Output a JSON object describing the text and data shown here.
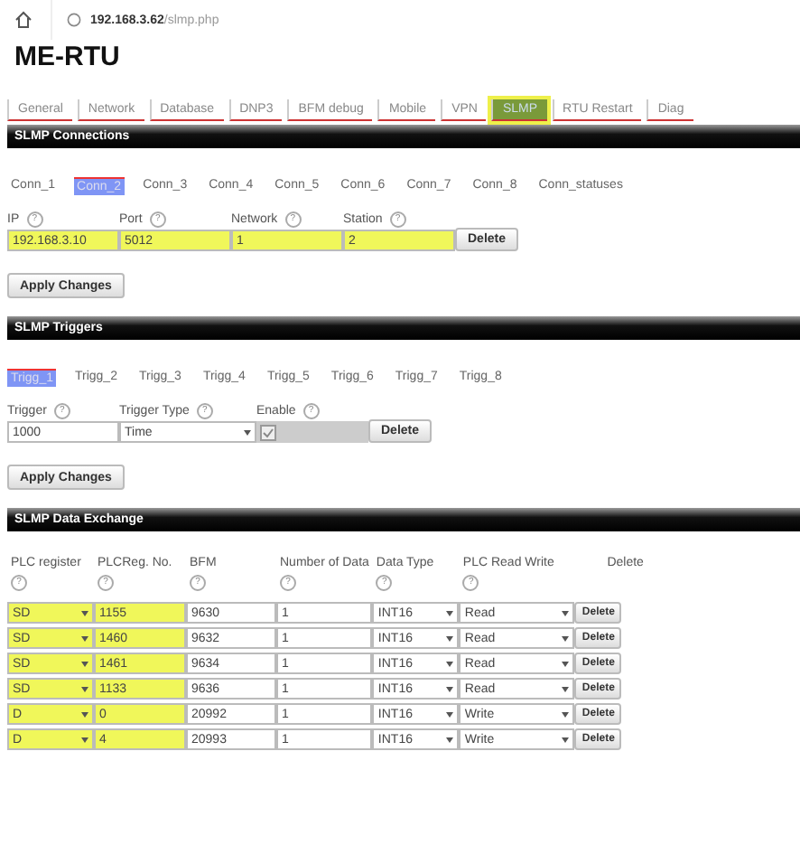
{
  "browser": {
    "url_host": "192.168.3.62",
    "url_path": "/slmp.php"
  },
  "title": "ME-RTU",
  "nav_tabs": [
    {
      "label": "General",
      "selected": false
    },
    {
      "label": "Network",
      "selected": false
    },
    {
      "label": "Database",
      "selected": false
    },
    {
      "label": "DNP3",
      "selected": false
    },
    {
      "label": "BFM debug",
      "selected": false
    },
    {
      "label": "Mobile",
      "selected": false
    },
    {
      "label": "VPN",
      "selected": false
    },
    {
      "label": "SLMP",
      "selected": true
    },
    {
      "label": "RTU Restart",
      "selected": false
    },
    {
      "label": "Diag",
      "selected": false
    }
  ],
  "connections": {
    "header": "SLMP Connections",
    "tabs": [
      {
        "label": "Conn_1",
        "selected": false
      },
      {
        "label": "Conn_2",
        "selected": true
      },
      {
        "label": "Conn_3",
        "selected": false
      },
      {
        "label": "Conn_4",
        "selected": false
      },
      {
        "label": "Conn_5",
        "selected": false
      },
      {
        "label": "Conn_6",
        "selected": false
      },
      {
        "label": "Conn_7",
        "selected": false
      },
      {
        "label": "Conn_8",
        "selected": false
      },
      {
        "label": "Conn_statuses",
        "selected": false
      }
    ],
    "fields": [
      {
        "label": "IP",
        "help": "?",
        "value": "192.168.3.10",
        "highlighted": true
      },
      {
        "label": "Port",
        "help": "?",
        "value": "5012",
        "highlighted": true
      },
      {
        "label": "Network",
        "help": "?",
        "value": "1",
        "highlighted": true
      },
      {
        "label": "Station",
        "help": "?",
        "value": "2",
        "highlighted": true
      }
    ],
    "delete_button": "Delete",
    "apply_button": "Apply Changes"
  },
  "triggers": {
    "header": "SLMP Triggers",
    "tabs": [
      {
        "label": "Trigg_1",
        "selected": true
      },
      {
        "label": "Trigg_2",
        "selected": false
      },
      {
        "label": "Trigg_3",
        "selected": false
      },
      {
        "label": "Trigg_4",
        "selected": false
      },
      {
        "label": "Trigg_5",
        "selected": false
      },
      {
        "label": "Trigg_6",
        "selected": false
      },
      {
        "label": "Trigg_7",
        "selected": false
      },
      {
        "label": "Trigg_8",
        "selected": false
      }
    ],
    "trigger_label": "Trigger",
    "trigger_help": "?",
    "trigger_value": "1000",
    "type_label": "Trigger Type",
    "type_help": "?",
    "type_value": "Time",
    "enable_label": "Enable",
    "enable_help": "?",
    "enable_checked": true,
    "delete_button": "Delete",
    "apply_button": "Apply Changes"
  },
  "data_exchange": {
    "header": "SLMP Data Exchange",
    "columns": [
      {
        "label": "PLC register",
        "help": "?"
      },
      {
        "label": "PLCReg. No.",
        "help": "?"
      },
      {
        "label": "BFM",
        "help": "?"
      },
      {
        "label": "Number of Data",
        "help": "?"
      },
      {
        "label": "Data Type",
        "help": "?"
      },
      {
        "label": "PLC Read Write",
        "help": "?"
      },
      {
        "label": "Delete"
      }
    ],
    "rows": [
      {
        "register": "SD",
        "reg_no": "1155",
        "highlighted": true,
        "bfm": "9630",
        "count": "1",
        "type": "INT16",
        "rw": "Read",
        "delete": "Delete"
      },
      {
        "register": "SD",
        "reg_no": "1460",
        "highlighted": true,
        "bfm": "9632",
        "count": "1",
        "type": "INT16",
        "rw": "Read",
        "delete": "Delete"
      },
      {
        "register": "SD",
        "reg_no": "1461",
        "highlighted": true,
        "bfm": "9634",
        "count": "1",
        "type": "INT16",
        "rw": "Read",
        "delete": "Delete"
      },
      {
        "register": "SD",
        "reg_no": "1133",
        "highlighted": true,
        "bfm": "9636",
        "count": "1",
        "type": "INT16",
        "rw": "Read",
        "delete": "Delete"
      },
      {
        "register": "D",
        "reg_no": "0",
        "highlighted": true,
        "bfm": "20992",
        "count": "1",
        "type": "INT16",
        "rw": "Write",
        "delete": "Delete"
      },
      {
        "register": "D",
        "reg_no": "4",
        "highlighted": true,
        "bfm": "20993",
        "count": "1",
        "type": "INT16",
        "rw": "Write",
        "delete": "Delete"
      }
    ]
  }
}
